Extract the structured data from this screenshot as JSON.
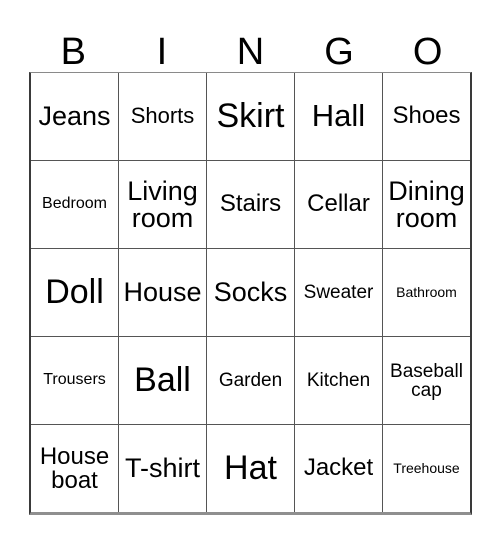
{
  "card": {
    "type": "bingo-card",
    "title": "BINGO",
    "columns": 5,
    "rows": 5,
    "background_color": "#ffffff",
    "text_color": "#000000",
    "border_color": "#555555"
  },
  "header": {
    "letters": [
      "B",
      "I",
      "N",
      "G",
      "O"
    ]
  },
  "grid": {
    "rows": [
      {
        "cells": [
          {
            "label": "Jeans",
            "size": "lg"
          },
          {
            "label": "Shorts",
            "size": "sm"
          },
          {
            "label": "Skirt",
            "size": "xxl"
          },
          {
            "label": "Hall",
            "size": "xl"
          },
          {
            "label": "Shoes",
            "size": "md"
          }
        ]
      },
      {
        "cells": [
          {
            "label": "Bedroom",
            "size": "xxs",
            "lines": 1
          },
          {
            "label": "Living room",
            "size": "lg",
            "lines": 2
          },
          {
            "label": "Stairs",
            "size": "md"
          },
          {
            "label": "Cellar",
            "size": "md"
          },
          {
            "label": "Dining room",
            "size": "lg",
            "lines": 2
          }
        ]
      },
      {
        "cells": [
          {
            "label": "Doll",
            "size": "xxl"
          },
          {
            "label": "House",
            "size": "lg"
          },
          {
            "label": "Socks",
            "size": "lg"
          },
          {
            "label": "Sweater",
            "size": "xs"
          },
          {
            "label": "Bathroom",
            "size": "min"
          }
        ]
      },
      {
        "cells": [
          {
            "label": "Trousers",
            "size": "xxs"
          },
          {
            "label": "Ball",
            "size": "xxl"
          },
          {
            "label": "Garden",
            "size": "xs"
          },
          {
            "label": "Kitchen",
            "size": "xs"
          },
          {
            "label": "Baseball cap",
            "size": "xs",
            "lines": 2
          }
        ]
      },
      {
        "cells": [
          {
            "label": "House boat",
            "size": "md",
            "lines": 2
          },
          {
            "label": "T-shirt",
            "size": "lg",
            "lines": 2
          },
          {
            "label": "Hat",
            "size": "xxl"
          },
          {
            "label": "Jacket",
            "size": "md"
          },
          {
            "label": "Treehouse",
            "size": "min"
          }
        ]
      }
    ]
  }
}
